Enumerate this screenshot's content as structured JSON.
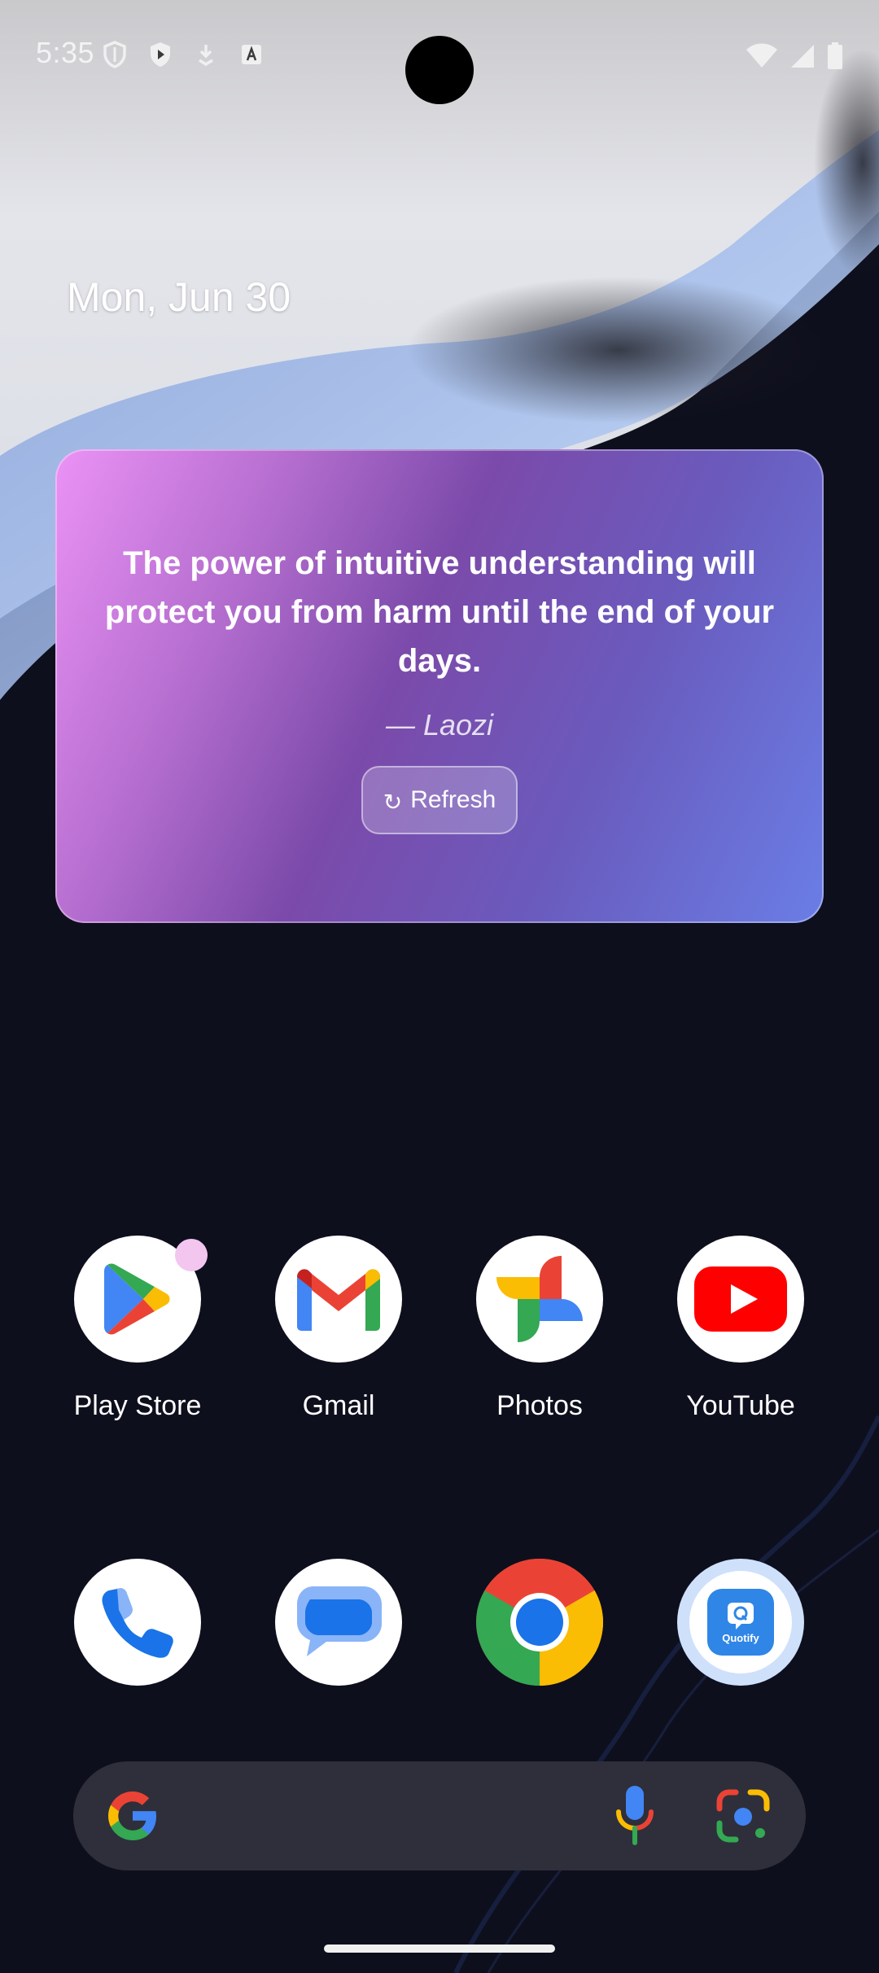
{
  "status_bar": {
    "time": "5:35",
    "left_icons": [
      "shield-icon",
      "play-protect-icon",
      "download-icon",
      "keyboard-a-icon"
    ],
    "right_icons": [
      "wifi-icon",
      "signal-icon",
      "battery-icon"
    ]
  },
  "home": {
    "date": "Mon, Jun 30"
  },
  "quote_widget": {
    "quote": "The power of intuitive understanding will protect you from harm until the end of your days.",
    "author": "— Laozi",
    "refresh_icon": "↻",
    "refresh_label": "Refresh",
    "gradient": [
      "#eb92f5",
      "#7b4aaa",
      "#6a7ee6"
    ]
  },
  "apps_row1": [
    {
      "name": "Play Store",
      "icon": "play-store-icon"
    },
    {
      "name": "Gmail",
      "icon": "gmail-icon"
    },
    {
      "name": "Photos",
      "icon": "photos-icon"
    },
    {
      "name": "YouTube",
      "icon": "youtube-icon"
    }
  ],
  "apps_row2": [
    {
      "icon": "phone-icon"
    },
    {
      "icon": "messages-icon"
    },
    {
      "icon": "chrome-icon"
    },
    {
      "icon": "quotify-icon",
      "text": "Quotify"
    }
  ],
  "search_bar": {
    "icons": [
      "google-g-icon",
      "mic-icon",
      "lens-icon"
    ]
  },
  "colors": {
    "google_blue": "#4285f4",
    "google_red": "#ea4335",
    "google_yellow": "#fbbc04",
    "google_green": "#34a853"
  }
}
